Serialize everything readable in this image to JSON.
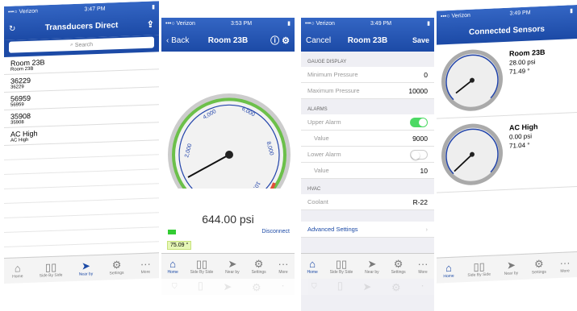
{
  "phone1": {
    "status": {
      "carrier": "•••○ Verizon",
      "time": "3:47 PM"
    },
    "title": "Transducers Direct",
    "search_placeholder": "Search",
    "items": [
      {
        "title": "Room 23B",
        "sub": "Room 23B"
      },
      {
        "title": "36229",
        "sub": "36229"
      },
      {
        "title": "56959",
        "sub": "56959"
      },
      {
        "title": "35908",
        "sub": "35908"
      },
      {
        "title": "AC High",
        "sub": "AC High"
      }
    ]
  },
  "phone2": {
    "status": {
      "carrier": "•••○ Verizon",
      "time": "3:53 PM"
    },
    "back": "Back",
    "title": "Room 23B",
    "gauge_ticks": [
      "0",
      "2,000",
      "4,000",
      "6,000",
      "8,000",
      "10,000"
    ],
    "pressure_value": 644.0,
    "pressure_display": "644.00 psi",
    "disconnect": "Disconnect",
    "temperature": "75.09 °"
  },
  "phone3": {
    "status": {
      "carrier": "•••○ Verizon",
      "time": "3:49 PM"
    },
    "cancel": "Cancel",
    "title": "Room 23B",
    "save": "Save",
    "gauge_section": "GAUGE DISPLAY",
    "min_label": "Minimum Pressure",
    "min_value": "0",
    "max_label": "Maximum Pressure",
    "max_value": "10000",
    "alarms_section": "ALARMS",
    "upper_label": "Upper Alarm",
    "upper_on": true,
    "upper_value_label": "Value",
    "upper_value": "9000",
    "lower_label": "Lower Alarm",
    "lower_on": false,
    "lower_value_label": "Value",
    "lower_value": "10",
    "hvac_section": "HVAC",
    "coolant_label": "Coolant",
    "coolant_value": "R-22",
    "advanced": "Advanced Settings"
  },
  "phone4": {
    "status": {
      "carrier": "•••○ Verizon",
      "time": "3:49 PM"
    },
    "title": "Connected Sensors",
    "sensors": [
      {
        "name": "Room 23B",
        "pressure": "28.00 psi",
        "temp": "71.49 °"
      },
      {
        "name": "AC High",
        "pressure": "0.00 psi",
        "temp": "71.04 °"
      }
    ]
  },
  "tabs": [
    "Home",
    "Side By Side",
    "Near by",
    "Settings",
    "More"
  ],
  "tabs_p1": [
    "Home",
    "Side By Side",
    "Near by",
    "Settings",
    "More"
  ],
  "colors": {
    "nav": "#1c4aa6",
    "accent": "#1c4aa6",
    "toggle_on": "#4cd964",
    "battery": "#33cc33"
  }
}
